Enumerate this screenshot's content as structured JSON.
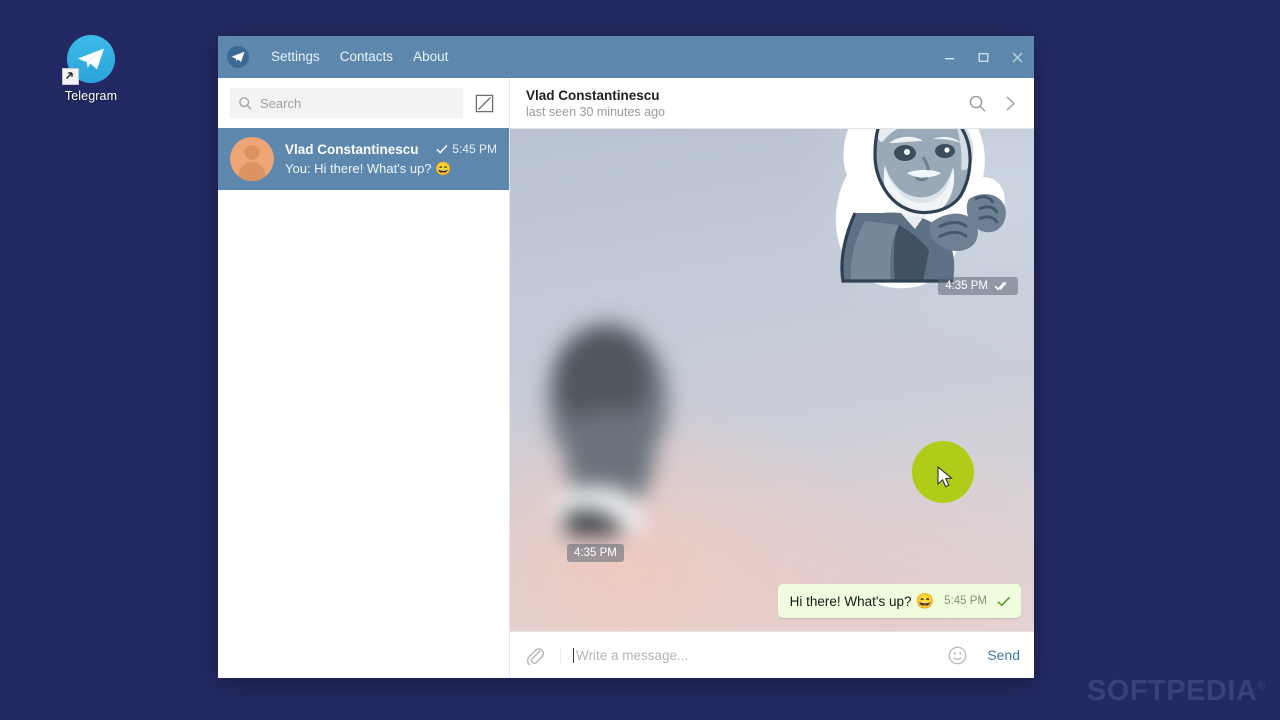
{
  "desktop": {
    "icon": {
      "name": "Telegram",
      "icon_name": "telegram-plane-icon",
      "badge_icon": "shortcut-arrow-icon",
      "accent": "#2aa3dc"
    },
    "watermark": {
      "text": "SOFTPEDIA",
      "mark": "®"
    },
    "background": "#232a63"
  },
  "window": {
    "titlebar": {
      "logo_icon": "telegram-logo-icon",
      "menu": [
        {
          "label": "Settings",
          "name": "menu-settings"
        },
        {
          "label": "Contacts",
          "name": "menu-contacts"
        },
        {
          "label": "About",
          "name": "menu-about"
        }
      ],
      "controls": [
        {
          "name": "minimize-button",
          "icon": "minimize-icon"
        },
        {
          "name": "maximize-button",
          "icon": "maximize-icon"
        },
        {
          "name": "close-button",
          "icon": "close-icon"
        }
      ],
      "background": "#5d87ac"
    },
    "sidebar": {
      "search": {
        "placeholder": "Search",
        "icon": "search-icon"
      },
      "compose": {
        "icon": "compose-pencil-icon"
      },
      "chats": [
        {
          "name": "Vlad Constantinescu",
          "time": "5:45 PM",
          "check_icon": "single-check-icon",
          "preview_prefix": "You: ",
          "preview": "Hi there! What's up?",
          "preview_emoji": "😄",
          "selected": true,
          "avatar_color": "#eda575"
        }
      ]
    },
    "chat": {
      "header": {
        "title": "Vlad Constantinescu",
        "status": "last seen 30 minutes ago",
        "search_icon": "search-icon",
        "more_icon": "chevron-right-icon"
      },
      "messages": [
        {
          "type": "sticker",
          "direction": "out",
          "description": "bearded-old-man-sticker",
          "time": "4:35 PM",
          "status_icon": "double-check-icon"
        },
        {
          "type": "sticker",
          "direction": "in",
          "description": "blurred-sticker",
          "time": "4:35 PM",
          "status_icon": ""
        },
        {
          "type": "text",
          "direction": "out",
          "text": "Hi there! What's up?",
          "emoji": "😄",
          "time": "5:45 PM",
          "status_icon": "single-check-icon",
          "bubble_color": "#effdde"
        }
      ],
      "composer": {
        "attach_icon": "paperclip-icon",
        "placeholder": "Write a message...",
        "emoji_icon": "smiley-icon",
        "send_label": "Send",
        "send_color": "#3a7ca8"
      }
    }
  },
  "cursor": {
    "highlight_color": "#b0cc18",
    "icon": "mouse-pointer-icon"
  }
}
